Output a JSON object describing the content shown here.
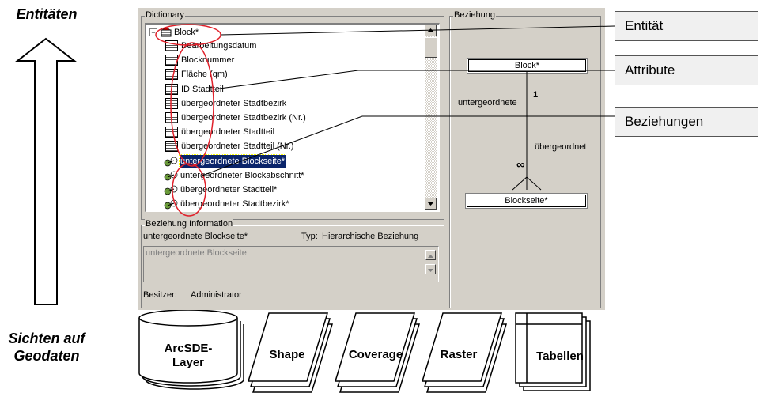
{
  "left_labels": {
    "top": "Entitäten",
    "bottom_line1": "Sichten auf",
    "bottom_line2": "Geodaten"
  },
  "dictionary": {
    "title": "Dictionary",
    "root": "Block*",
    "attributes": [
      "Bearbeitungsdatum",
      "Blocknummer",
      "Fläche (qm)",
      "ID Stadtteil",
      "übergeordneter Stadtbezirk",
      "übergeordneter Stadtbezirk (Nr.)",
      "übergeordneter Stadtteil",
      "übergeordneter Stadtteil (Nr.)"
    ],
    "relations": [
      "untergeordnete Blockseite*",
      "untergeordneter Blockabschnitt*",
      "übergeordneter Stadtteil*",
      "übergeordneter Stadtbezirk*"
    ],
    "selected": "untergeordnete Blockseite*"
  },
  "beziehung_info": {
    "title": "Beziehung Information",
    "name": "untergeordnete Blockseite*",
    "typ_label": "Typ:",
    "typ_value": "Hierarchische Beziehung",
    "description": "untergeordnete Blockseite",
    "besitzer_label": "Besitzer:",
    "besitzer_value": "Administrator"
  },
  "beziehung": {
    "title": "Beziehung",
    "top_entity": "Block*",
    "bottom_entity": "Blockseite*",
    "left_role": "untergeordnete",
    "right_role": "übergeordnet",
    "card_top": "1",
    "card_bottom": "∞"
  },
  "callouts": [
    "Entität",
    "Attribute",
    "Beziehungen"
  ],
  "sources": [
    "ArcSDE-\nLayer",
    "Shape",
    "Coverage",
    "Raster",
    "Tabellen"
  ],
  "colors": {
    "panel": "#d4d0c8",
    "selection": "#0a246a",
    "annotation": "#e0202a"
  }
}
